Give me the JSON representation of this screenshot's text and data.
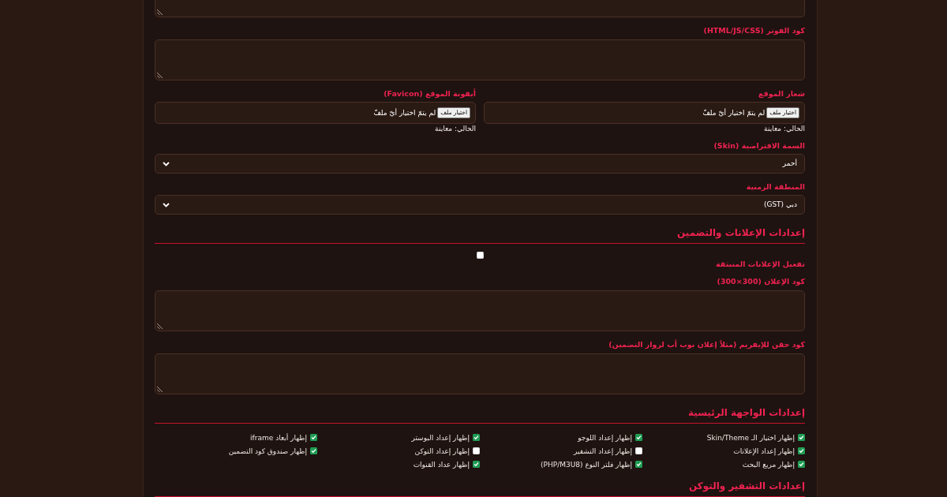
{
  "form": {
    "items": [
      {
        "kind": "textarea_cut"
      },
      {
        "kind": "textarea",
        "label": "كود الفوتر (HTML/JS/CSS)"
      },
      {
        "kind": "file_pair",
        "files": [
          {
            "label": "شعار الموقع",
            "button": "اختيار ملف",
            "status": "لم يتمّ اختيار أيّ ملفّ",
            "current": "الحالي: معاينة"
          },
          {
            "label": "أيقونة الموقع (Favicon)",
            "button": "اختيار ملف",
            "status": "لم يتمّ اختيار أيّ ملفّ",
            "current": "الحالي: معاينة"
          }
        ]
      },
      {
        "kind": "select",
        "label": "السمة الافتراضية (Skin)",
        "value": "أحمر"
      },
      {
        "kind": "select",
        "label": "المنطقة الزمنية",
        "value": "دبي (GST)"
      },
      {
        "kind": "heading",
        "title": "إعدادات الإعلانات والتضمين"
      },
      {
        "kind": "checkbox",
        "label": "تفعيل الإعلانات المنبثقة",
        "checked": false
      },
      {
        "kind": "textarea",
        "label": "كود الإعلان (300×300)"
      },
      {
        "kind": "textarea",
        "label": "كود حقن للإيفريم (مثلاً إعلان بوب أب لزوار التضمين)"
      },
      {
        "kind": "heading",
        "title": "إعدادات الواجهة الرئيسية"
      },
      {
        "kind": "checkbox_grid",
        "options": [
          {
            "label": "إظهار اختيار الـ Skin/Theme",
            "checked": true
          },
          {
            "label": "إظهار إعداد اللوجو",
            "checked": true
          },
          {
            "label": "إظهار إعداد البوستر",
            "checked": true
          },
          {
            "label": "إظهار أبعاد iframe",
            "checked": true
          },
          {
            "label": "إظهار إعداد الإعلانات",
            "checked": true
          },
          {
            "label": "إظهار إعداد التشفير",
            "checked": false
          },
          {
            "label": "إظهار إعداد التوكن",
            "checked": false
          },
          {
            "label": "إظهار صندوق كود التضمين",
            "checked": true
          },
          {
            "label": "إظهار مربع البحث",
            "checked": true
          },
          {
            "label": "إظهار فلتر النوع (PHP/M3U8)",
            "checked": true
          },
          {
            "label": "إظهار عداد القنوات",
            "checked": true
          }
        ]
      },
      {
        "kind": "heading",
        "title": "إعدادات التشفير والتوكن"
      }
    ]
  }
}
